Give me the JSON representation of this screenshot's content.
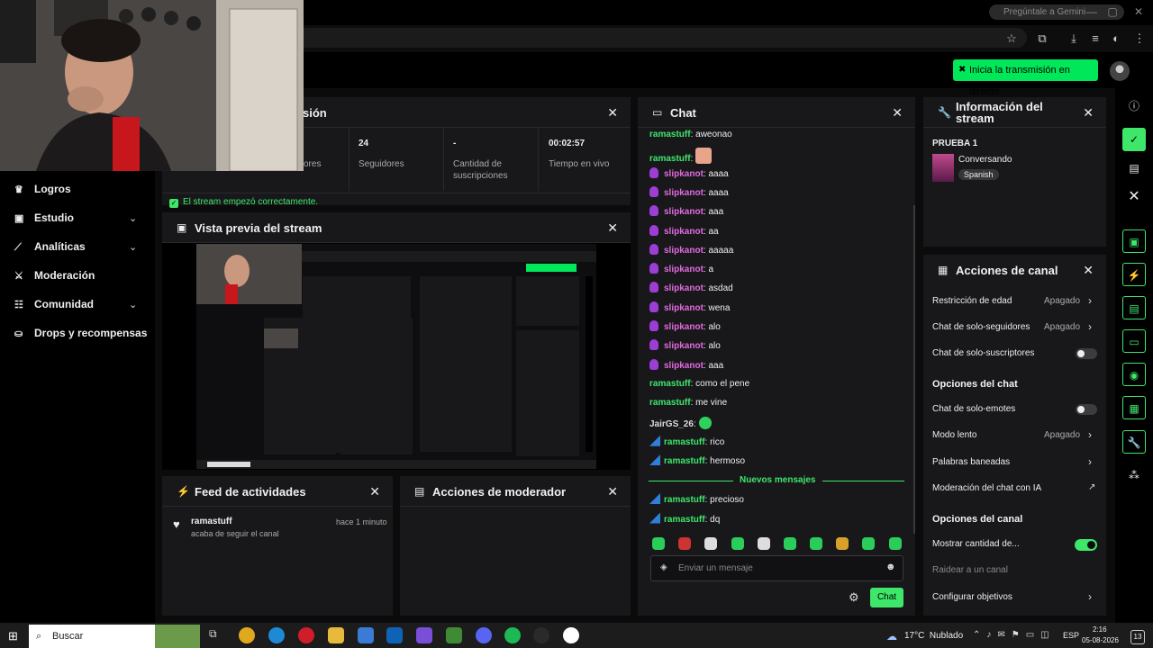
{
  "browser": {
    "gemini_label": "Pregúntale a Gemini",
    "window_controls": [
      "—",
      "▢",
      "✕"
    ]
  },
  "header": {
    "live_button_label": "Inicia la transmisión en directo"
  },
  "nav": {
    "items": [
      {
        "label": "Logros",
        "icon": "trophy-icon",
        "has_chevron": false
      },
      {
        "label": "Estudio",
        "icon": "studio-icon",
        "has_chevron": true
      },
      {
        "label": "Analíticas",
        "icon": "analytics-icon",
        "has_chevron": true
      },
      {
        "label": "Moderación",
        "icon": "sword-icon",
        "has_chevron": false
      },
      {
        "label": "Comunidad",
        "icon": "community-icon",
        "has_chevron": true
      },
      {
        "label": "Drops y recompensas",
        "icon": "gift-icon",
        "has_chevron": false
      }
    ]
  },
  "session": {
    "title_partial": "sión",
    "stats": [
      {
        "value": "",
        "label": "ores"
      },
      {
        "value": "24",
        "label": "Seguidores"
      },
      {
        "value": "-",
        "label": "Cantidad de suscripciones"
      },
      {
        "value": "00:02:57",
        "label": "Tiempo en vivo"
      }
    ],
    "status": "El stream empezó correctamente."
  },
  "preview": {
    "title": "Vista previa del stream"
  },
  "activity": {
    "title": "Feed de actividades",
    "items": [
      {
        "user": "ramastuff",
        "text": "acaba de seguir el canal",
        "time": "hace 1 minuto"
      }
    ]
  },
  "mod_actions": {
    "title": "Acciones de moderador"
  },
  "chat": {
    "title": "Chat",
    "messages": [
      {
        "user": "ramastuff",
        "text": "aweonao",
        "style": "green",
        "badge": ""
      },
      {
        "user": "ramastuff",
        "text": "",
        "style": "green",
        "badge": "",
        "emote": "hand"
      },
      {
        "user": "slipkanot",
        "text": "aaaa",
        "style": "pink",
        "badge": "mic"
      },
      {
        "user": "slipkanot",
        "text": "aaaa",
        "style": "pink",
        "badge": "mic"
      },
      {
        "user": "slipkanot",
        "text": "aaa",
        "style": "pink",
        "badge": "mic"
      },
      {
        "user": "slipkanot",
        "text": "aa",
        "style": "pink",
        "badge": "mic"
      },
      {
        "user": "slipkanot",
        "text": "aaaaa",
        "style": "pink",
        "badge": "mic"
      },
      {
        "user": "slipkanot",
        "text": "a",
        "style": "pink",
        "badge": "mic"
      },
      {
        "user": "slipkanot",
        "text": "asdad",
        "style": "pink",
        "badge": "mic"
      },
      {
        "user": "slipkanot",
        "text": "wena",
        "style": "pink",
        "badge": "mic"
      },
      {
        "user": "slipkanot",
        "text": "alo",
        "style": "pink",
        "badge": "mic"
      },
      {
        "user": "slipkanot",
        "text": "alo",
        "style": "pink",
        "badge": "mic"
      },
      {
        "user": "slipkanot",
        "text": "aaa",
        "style": "pink",
        "badge": "mic"
      },
      {
        "user": "ramastuff",
        "text": "como el pene",
        "style": "green",
        "badge": ""
      },
      {
        "user": "ramastuff",
        "text": "me vine",
        "style": "green",
        "badge": ""
      },
      {
        "user": "JairGS_26",
        "text": "",
        "style": "gray",
        "badge": "",
        "emote": "green"
      },
      {
        "user": "ramastuff",
        "text": "rico",
        "style": "green",
        "badge": "blue"
      },
      {
        "user": "ramastuff",
        "text": "hermoso",
        "style": "green",
        "badge": "blue"
      }
    ],
    "divider": "Nuevos mensajes",
    "new_messages": [
      {
        "user": "ramastuff",
        "text": "precioso",
        "style": "green",
        "badge": "blue"
      },
      {
        "user": "ramastuff",
        "text": "dq",
        "style": "green",
        "badge": "blue"
      }
    ],
    "input_placeholder": "Enviar un mensaje",
    "send_label": "Chat"
  },
  "stream_info": {
    "title": "Información del stream",
    "stream_title": "PRUEBA 1",
    "category": "Conversando",
    "language": "Spanish"
  },
  "channel_actions": {
    "title": "Acciones de canal",
    "rows": [
      {
        "label": "Restricción de edad",
        "value": "Apagado",
        "control": "chevron"
      },
      {
        "label": "Chat de solo-seguidores",
        "value": "Apagado",
        "control": "chevron"
      },
      {
        "label": "Chat de solo-suscriptores",
        "value": "",
        "control": "toggle-off"
      }
    ],
    "section_chat": "Opciones del chat",
    "chat_rows": [
      {
        "label": "Chat de solo-emotes",
        "value": "",
        "control": "toggle-off"
      },
      {
        "label": "Modo lento",
        "value": "Apagado",
        "control": "chevron"
      },
      {
        "label": "Palabras baneadas",
        "value": "",
        "control": "chevron"
      },
      {
        "label": "Moderación del chat con IA",
        "value": "",
        "control": "external"
      }
    ],
    "section_channel": "Opciones del canal",
    "channel_rows": [
      {
        "label": "Mostrar cantidad de...",
        "value": "",
        "control": "toggle-on"
      },
      {
        "label": "Raidear a un canal",
        "value": "",
        "control": "none",
        "muted": true
      },
      {
        "label": "Configurar objetivos",
        "value": "",
        "control": "chevron"
      }
    ]
  },
  "taskbar": {
    "search_placeholder": "Buscar",
    "weather": "17°C  Nublado",
    "lang": "ESP",
    "time": "2:16",
    "date": "05-08-2026",
    "notifications": "13"
  },
  "colors": {
    "accent": "#3ee66a",
    "live": "#00e85a",
    "panel": "#18181b",
    "pink_user": "#e26ae0"
  }
}
